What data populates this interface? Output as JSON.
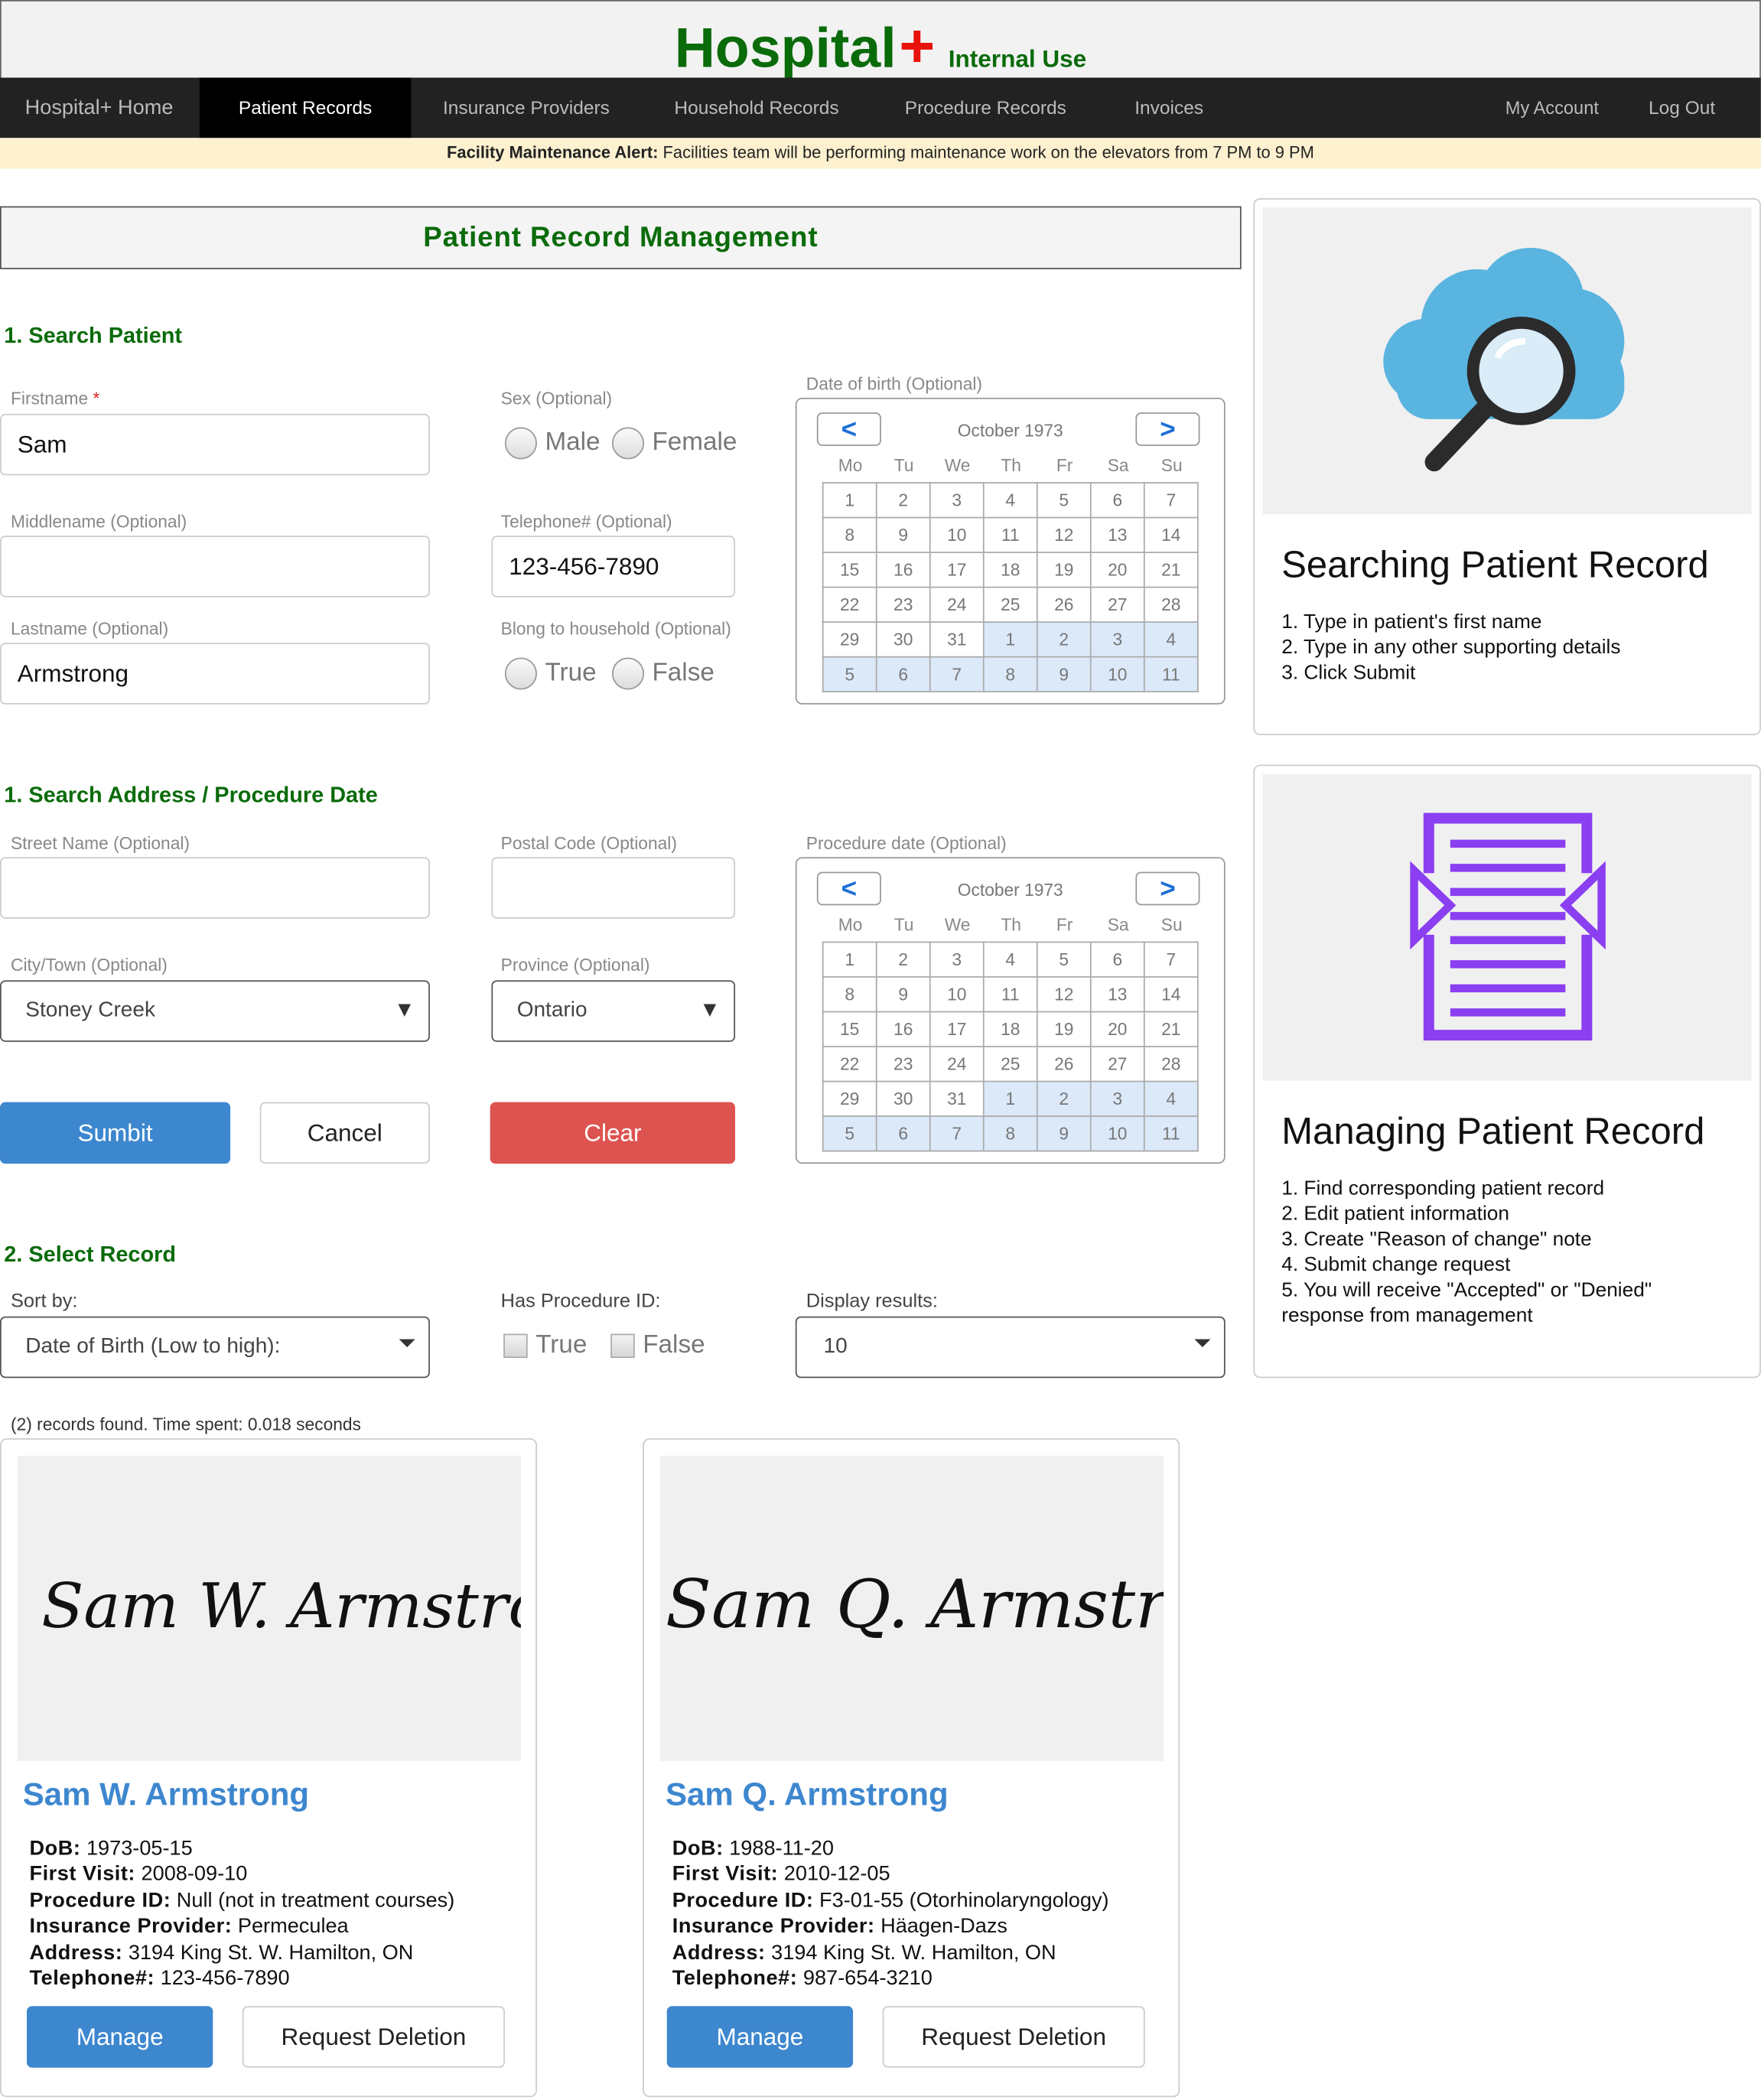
{
  "header": {
    "brand": "Hospital",
    "plus": "+",
    "subtitle": "Internal Use"
  },
  "nav": {
    "items": [
      "Hospital+ Home",
      "Patient Records",
      "Insurance Providers",
      "Household Records",
      "Procedure Records",
      "Invoices"
    ],
    "right": [
      "My Account",
      "Log Out"
    ],
    "active": "Patient Records"
  },
  "alert": {
    "label": "Facility Maintenance Alert:",
    "text": " Facilities team will be performing maintenance work on the elevators from 7 PM to 9 PM"
  },
  "page_title": "Patient Record Management",
  "search_patient": {
    "heading": "1. Search Patient",
    "firstname_label": "Firstname",
    "required_mark": "*",
    "firstname_value": "Sam",
    "middlename_label": "Middlename (Optional)",
    "middlename_value": "",
    "lastname_label": "Lastname (Optional)",
    "lastname_value": "Armstrong",
    "sex_label": "Sex (Optional)",
    "sex_options": [
      "Male",
      "Female"
    ],
    "telephone_label": "Telephone# (Optional)",
    "telephone_value": "123-456-7890",
    "household_label": "Blong to household (Optional)",
    "household_options": [
      "True",
      "False"
    ],
    "dob_label": "Date of birth (Optional)"
  },
  "calendar": {
    "month": "October 1973",
    "prev": "<",
    "next": ">",
    "weekdays": [
      "Mo",
      "Tu",
      "We",
      "Th",
      "Fr",
      "Sa",
      "Su"
    ],
    "weeks": [
      [
        "1",
        "2",
        "3",
        "4",
        "5",
        "6",
        "7"
      ],
      [
        "8",
        "9",
        "10",
        "11",
        "12",
        "13",
        "14"
      ],
      [
        "15",
        "16",
        "17",
        "18",
        "19",
        "20",
        "21"
      ],
      [
        "22",
        "23",
        "24",
        "25",
        "26",
        "27",
        "28"
      ],
      [
        "29",
        "30",
        "31",
        "1",
        "2",
        "3",
        "4"
      ],
      [
        "5",
        "6",
        "7",
        "8",
        "9",
        "10",
        "11"
      ]
    ]
  },
  "search_address": {
    "heading": "1. Search Address / Procedure Date",
    "street_label": "Street Name (Optional)",
    "street_value": "",
    "postal_label": "Postal Code (Optional)",
    "postal_value": "",
    "city_label": "City/Town (Optional)",
    "city_value": "Stoney Creek",
    "province_label": "Province (Optional)",
    "province_value": "Ontario",
    "procedure_label": "Procedure date (Optional)"
  },
  "buttons": {
    "submit": "Sumbit",
    "cancel": "Cancel",
    "clear": "Clear"
  },
  "select_record": {
    "heading": "2. Select Record",
    "sort_label": "Sort by:",
    "sort_value": "Date of Birth (Low to high):",
    "procid_label": "Has Procedure ID:",
    "procid_options": [
      "True",
      "False"
    ],
    "display_label": "Display results:",
    "display_value": "10"
  },
  "found_text": "(2) records found. Time spent: 0.018 seconds",
  "info_cards": [
    {
      "title": "Searching Patient Record",
      "steps": [
        "1. Type in patient's first name",
        "2. Type in any other supporting details",
        "3. Click Submit"
      ]
    },
    {
      "title": "Managing Patient Record",
      "steps": [
        "1. Find corresponding patient record",
        "2. Edit patient information",
        "3. Create \"Reason of change\" note",
        "4. Submit change request",
        "5. You will receive \"Accepted\" or \"Denied\"",
        "response from management"
      ]
    }
  ],
  "field_labels": {
    "dob": "DoB:",
    "first_visit": "First Visit:",
    "procedure_id": "Procedure ID:",
    "insurance": "Insurance Provider:",
    "address": "Address:",
    "telephone": "Telephone#:"
  },
  "records": [
    {
      "name": "Sam W. Armstrong",
      "signature": "Sam W. Armstrong",
      "dob": " 1973-05-15",
      "first_visit": " 2008-09-10",
      "procedure_id": " Null (not in treatment courses)",
      "insurance": " Permeculea",
      "address": " 3194 King St. W. Hamilton, ON",
      "telephone": " 123-456-7890",
      "manage": "Manage",
      "delete": "Request Deletion"
    },
    {
      "name": "Sam Q. Armstrong",
      "signature": "Sam Q. Armstrong",
      "dob": " 1988-11-20",
      "first_visit": " 2010-12-05",
      "procedure_id": " F3-01-55 (Otorhinolaryngology)",
      "insurance": " Häagen-Dazs",
      "address": " 3194 King St. W. Hamilton, ON",
      "telephone": " 987-654-3210",
      "manage": "Manage",
      "delete": "Request Deletion"
    }
  ],
  "colors": {
    "brand_green": "#0a6b0a",
    "brand_red": "#e8120c",
    "accent_blue": "#3d87cf",
    "danger_red": "#dd534f",
    "alert_bg": "#fdf1d0"
  },
  "icons": [
    "cloud-search-icon",
    "document-icon"
  ]
}
